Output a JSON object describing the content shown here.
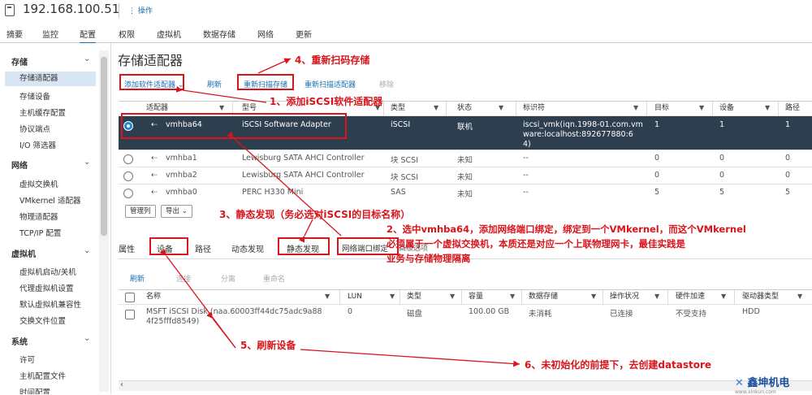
{
  "header": {
    "host": "192.168.100.51",
    "actions": "操作"
  },
  "tabs": [
    "摘要",
    "监控",
    "配置",
    "权限",
    "虚拟机",
    "数据存储",
    "网络",
    "更新"
  ],
  "sidebar": {
    "groups": [
      {
        "title": "存储",
        "items": [
          "存储适配器",
          "存储设备",
          "主机缓存配置",
          "协议端点",
          "I/O 筛选器"
        ]
      },
      {
        "title": "网络",
        "items": [
          "虚拟交换机",
          "VMkernel 适配器",
          "物理适配器",
          "TCP/IP 配置"
        ]
      },
      {
        "title": "虚拟机",
        "items": [
          "虚拟机启动/关机",
          "代理虚拟机设置",
          "默认虚拟机兼容性",
          "交换文件位置"
        ]
      },
      {
        "title": "系统",
        "items": [
          "许可",
          "主机配置文件",
          "时间配置"
        ]
      }
    ]
  },
  "page_title": "存储适配器",
  "toolbar": {
    "add": "添加软件适配器",
    "refresh": "刷新",
    "rescan_storage": "重新扫描存储",
    "rescan_adapter": "重新扫描适配器",
    "remove": "移除"
  },
  "adapters": {
    "columns": [
      "适配器",
      "型号",
      "类型",
      "状态",
      "标识符",
      "目标",
      "设备",
      "路径"
    ],
    "rows": [
      {
        "name": "vmhba64",
        "model": "iSCSI Software Adapter",
        "type": "iSCSI",
        "status": "联机",
        "id": "iscsi_vmk(iqn.1998-01.com.vmware:localhost:892677880:64)",
        "id1": "iscsi_vmk(iqn.1998-01.com.vm",
        "id2": "ware:localhost:892677880:6",
        "id3": "4)",
        "targets": "1",
        "devices": "1",
        "paths": "1"
      },
      {
        "name": "vmhba1",
        "model": "Lewisburg SATA AHCI Controller",
        "type": "块 SCSI",
        "status": "未知",
        "id": "--",
        "targets": "0",
        "devices": "0",
        "paths": "0"
      },
      {
        "name": "vmhba2",
        "model": "Lewisburg SATA AHCI Controller",
        "type": "块 SCSI",
        "status": "未知",
        "id": "--",
        "targets": "0",
        "devices": "0",
        "paths": "0"
      },
      {
        "name": "vmhba0",
        "model": "PERC H330 Mini",
        "type": "SAS",
        "status": "未知",
        "id": "--",
        "targets": "5",
        "devices": "5",
        "paths": "5"
      }
    ],
    "footer": {
      "manage_columns": "管理列",
      "export": "导出"
    }
  },
  "detail_tabs": [
    "属性",
    "设备",
    "路径",
    "动态发现",
    "静态发现",
    "网络端口绑定",
    "高级选项"
  ],
  "device_actions": [
    "刷新",
    "连接",
    "分离",
    "重命名"
  ],
  "devices": {
    "columns": [
      "名称",
      "LUN",
      "类型",
      "容量",
      "数据存储",
      "操作状况",
      "硬件加速",
      "驱动器类型"
    ],
    "rows": [
      {
        "name1": "MSFT iSCSI Disk (naa.60003ff44dc75adc9a88",
        "name2": "4f25fffd8549)",
        "lun": "0",
        "type": "磁盘",
        "capacity": "100.00 GB",
        "datastore": "未消耗",
        "op": "已连接",
        "hw": "不受支持",
        "drive": "HDD"
      }
    ]
  },
  "annotations": {
    "a1": "1、添加iSCSI软件适配器",
    "a2_1": "2、选中vmhba64，添加网络端口绑定，绑定到一个VMkernel，而这个VMkernel",
    "a2_2": "必须属于一个虚拟交换机，本质还是对应一个上联物理网卡，最佳实践是",
    "a2_3": "业务与存储物理隔离",
    "a3": "3、静态发现（务必选对iSCSI的目标名称）",
    "a4": "4、重新扫码存储",
    "a5": "5、刷新设备",
    "a6": "6、未初始化的前提下，去创建datastore"
  },
  "watermark": {
    "name": "鑫坤机电",
    "url": "www.xinkun.com"
  },
  "colors": {
    "accent": "#1a6fb0",
    "annotation": "#d9141b",
    "selected_row": "#2d3e4e"
  }
}
